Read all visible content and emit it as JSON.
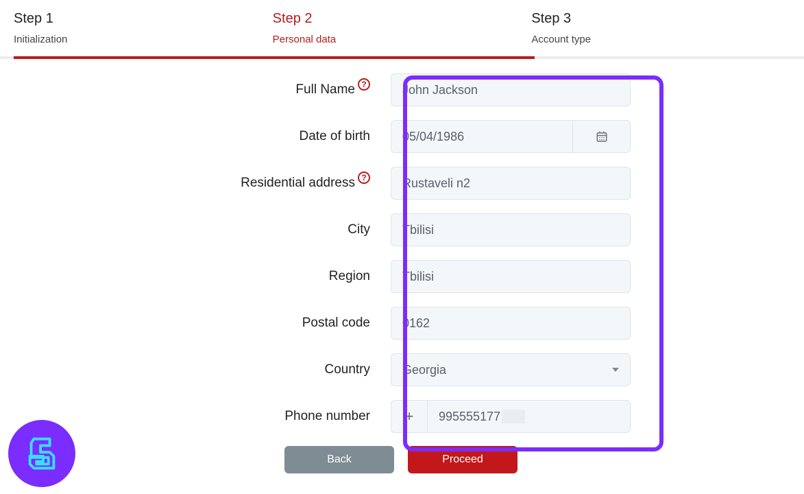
{
  "stepper": {
    "steps": [
      {
        "title": "Step 1",
        "subtitle": "Initialization"
      },
      {
        "title": "Step 2",
        "subtitle": "Personal data"
      },
      {
        "title": "Step 3",
        "subtitle": "Account type"
      }
    ],
    "active_index": 1
  },
  "form": {
    "full_name": {
      "label": "Full Name",
      "value": "John Jackson",
      "help": true
    },
    "dob": {
      "label": "Date of birth",
      "value": "05/04/1986"
    },
    "address": {
      "label": "Residential address",
      "value": "Rustaveli n2",
      "help": true
    },
    "city": {
      "label": "City",
      "value": "Tbilisi"
    },
    "region": {
      "label": "Region",
      "value": "Tbilisi"
    },
    "postal": {
      "label": "Postal code",
      "value": "0162"
    },
    "country": {
      "label": "Country",
      "value": "Georgia"
    },
    "phone": {
      "label": "Phone number",
      "prefix": "+",
      "value": "995555177"
    }
  },
  "buttons": {
    "back": "Back",
    "proceed": "Proceed"
  },
  "colors": {
    "accent": "#b71c1c",
    "highlight": "#7b2cff",
    "button_back": "#7e8c94",
    "button_proceed": "#c2181b"
  }
}
